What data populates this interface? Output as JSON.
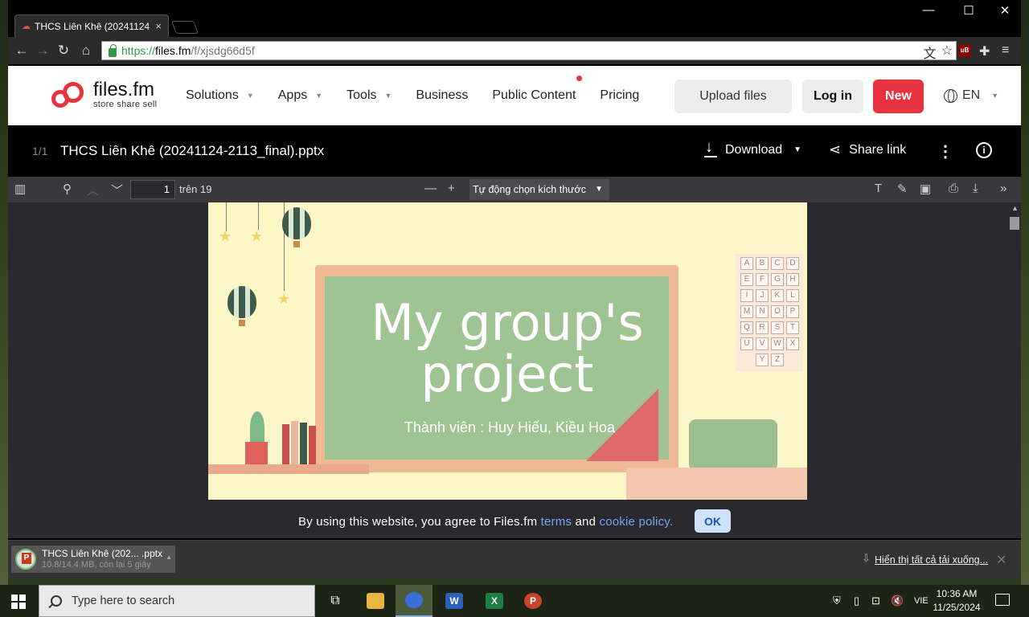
{
  "browser": {
    "tab_title": "THCS Liên Khê (20241124",
    "tab_close": "×",
    "url_scheme": "https://",
    "url_host": "files.fm",
    "url_path": "/f/xjsdg66d5f",
    "controls": {
      "minimize": "—",
      "maximize": "☐",
      "close": "✕"
    }
  },
  "site": {
    "logo_title": "files.fm",
    "logo_tagline": "store share sell",
    "menu": [
      {
        "label": "Solutions",
        "has_caret": true
      },
      {
        "label": "Apps",
        "has_caret": true
      },
      {
        "label": "Tools",
        "has_caret": true
      },
      {
        "label": "Business",
        "has_caret": false
      },
      {
        "label": "Public Content",
        "has_caret": false
      },
      {
        "label": "Pricing",
        "has_caret": false
      }
    ],
    "upload_label": "Upload files",
    "login_label": "Log in",
    "new_label": "New",
    "language": "EN",
    "brand_color": "#e8323e"
  },
  "file": {
    "count": "1/1",
    "name": "THCS Liên Khê (20241124-2113_final).pptx",
    "download_label": "Download",
    "share_label": "Share link"
  },
  "pdf": {
    "current_page": "1",
    "page_of": "trên 19",
    "zoom": "Tự động chọn kích thước"
  },
  "slide": {
    "title": "My group's project",
    "subtitle": "Thành viên : Huy Hiếu, Kiều Hoa",
    "letters": [
      "A",
      "B",
      "C",
      "D",
      "E",
      "F",
      "G",
      "H",
      "I",
      "J",
      "K",
      "L",
      "M",
      "N",
      "O",
      "P",
      "Q",
      "R",
      "S",
      "T",
      "U",
      "V",
      "W",
      "X",
      "",
      "Y",
      "Z",
      ""
    ]
  },
  "cookie": {
    "text_before": "By using this website, you agree to Files.fm ",
    "terms": "terms",
    "and": " and ",
    "policy": "cookie policy.",
    "ok": "OK"
  },
  "downloads": {
    "name": "THCS Liên Khê (202... .pptx",
    "status": "10.8/14.4 MB, còn lại 5 giây",
    "show_all": "Hiển thị tất cả tải xuống..."
  },
  "taskbar": {
    "search_placeholder": "Type here to search",
    "language": "VIE",
    "time": "10:36 AM",
    "date": "11/25/2024"
  }
}
